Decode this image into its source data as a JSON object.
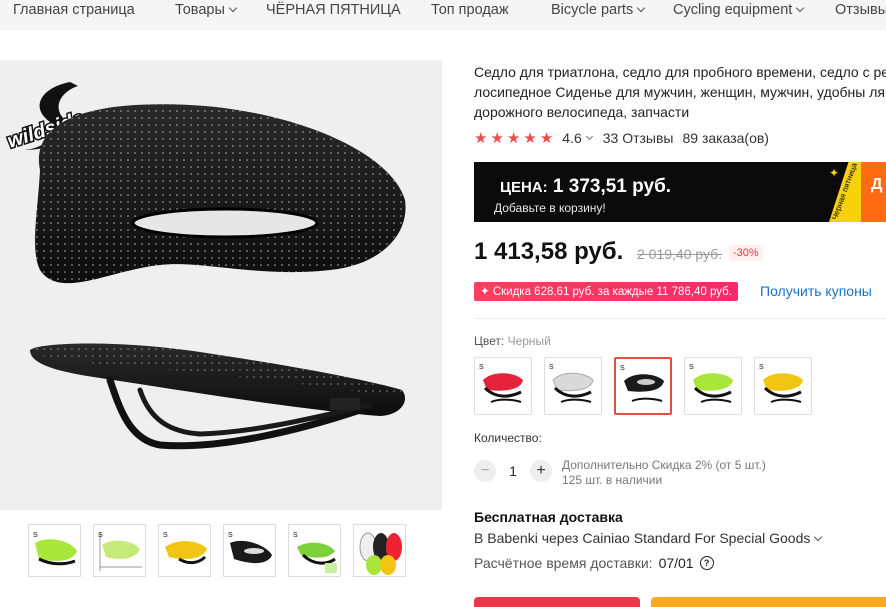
{
  "nav": {
    "items": [
      {
        "label": "Главная страница",
        "dropdown": false
      },
      {
        "label": "Товары",
        "dropdown": true
      },
      {
        "label": "ЧЁРНАЯ ПЯТНИЦА",
        "dropdown": false
      },
      {
        "label": "Топ продаж",
        "dropdown": false
      },
      {
        "label": "Bicycle parts",
        "dropdown": true
      },
      {
        "label": "Cycling equipment",
        "dropdown": true
      },
      {
        "label": "Отзывы",
        "dropdown": false
      }
    ]
  },
  "product": {
    "title": "Седло для триатлона, седло для пробного времени, седло с ре лосипедное Сиденье для мужчин, женщин, мужчин, удобны ля дорожного велосипеда, запчасти",
    "brand_logo_text": "wildside",
    "rating": "4.6",
    "reviews": "33 Отзывы",
    "orders": "89 заказа(ов)",
    "stars": 5
  },
  "promo": {
    "label": "ЦЕНА:",
    "price": "1 373,51 руб.",
    "subtitle": "Добавьте в корзину!",
    "ribbon_text": "Черная пятница",
    "side_text": "Д"
  },
  "pricing": {
    "price": "1 413,58 руб.",
    "old_price": "2 019,40 руб.",
    "discount": "-30%"
  },
  "coupon": {
    "text": "✦ Скидка 628,61 руб. за каждые 11 786,40 руб.",
    "link": "Получить купоны"
  },
  "color": {
    "label": "Цвет:",
    "value": "Черный",
    "swatches": [
      "red",
      "white",
      "black",
      "green",
      "yellow"
    ],
    "selected": 2
  },
  "quantity": {
    "label": "Количество:",
    "minus": "−",
    "plus": "+",
    "value": "1",
    "info_line1": "Дополнительно Скидка 2% (от 5 шт.)",
    "info_line2": "125 шт. в наличии"
  },
  "shipping": {
    "title": "Бесплатная доставка",
    "line": "В Babenki через Cainiao Standard For Special Goods",
    "time_label": "Расчётное время доставки:",
    "time_value": "07/01",
    "help": "?"
  },
  "colors": {
    "accent": "#e8394a",
    "promo_bg": "#0b0b0b",
    "coupon": "#ff2a6a",
    "link": "#1a73c7",
    "star": "#f04b4b"
  }
}
